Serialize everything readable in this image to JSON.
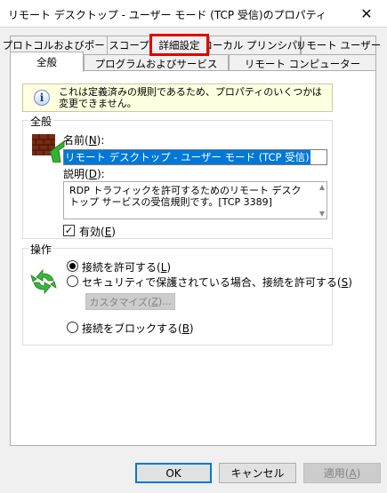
{
  "window": {
    "title": "リモート デスクトップ - ユーザー モード (TCP 受信)のプロパティ",
    "close_glyph": "✕"
  },
  "tabs_row1": [
    {
      "label": "プロトコルおよびポート"
    },
    {
      "label": "スコープ"
    },
    {
      "label": "詳細設定",
      "highlighted": true
    },
    {
      "label": "ローカル プリンシパル"
    },
    {
      "label": "リモート ユーザー"
    }
  ],
  "tabs_row2": [
    {
      "label": "全般",
      "active": true
    },
    {
      "label": "プログラムおよびサービス"
    },
    {
      "label": "リモート コンピューター"
    }
  ],
  "info": {
    "icon": "info-icon",
    "glyph": "i",
    "text_line1": "これは定義済みの規則であるため、プロパティのいくつかは",
    "text_line2": "変更できません。"
  },
  "general_group": {
    "label": "全般",
    "icon": "firewall-icon",
    "name_label": "名前(",
    "name_key": "N",
    "name_label_end": "):",
    "name_value": "リモート デスクトップ - ユーザー モード (TCP 受信)",
    "desc_label": "説明(",
    "desc_key": "D",
    "desc_label_end": "):",
    "desc_value": "RDP トラフィックを許可するためのリモート デスクトップ サービスの受信規則です。[TCP 3389]",
    "enabled_label": "有効(",
    "enabled_key": "E",
    "enabled_label_end": ")",
    "enabled_checked": true,
    "check_glyph": "✓"
  },
  "action_group": {
    "label": "操作",
    "icon": "recycle-icon",
    "allow_label": "接続を許可する(",
    "allow_key": "L",
    "allow_label_end": ")",
    "secure_label": "セキュリティで保護されている場合、接続を許可する(",
    "secure_key": "S",
    "secure_label_end": ")",
    "customize_label": "カスタマイズ(",
    "customize_key": "Z",
    "customize_label_end": ")...",
    "block_label": "接続をブロックする(",
    "block_key": "B",
    "block_label_end": ")",
    "selected": "allow"
  },
  "footer": {
    "ok_label": "OK",
    "cancel_label": "キャンセル",
    "apply_label": "適用(",
    "apply_key": "A",
    "apply_label_end": ")"
  },
  "colors": {
    "highlight_box": "#e00000",
    "selection_bg": "#0078d7",
    "info_bg": "#ffffe1"
  }
}
